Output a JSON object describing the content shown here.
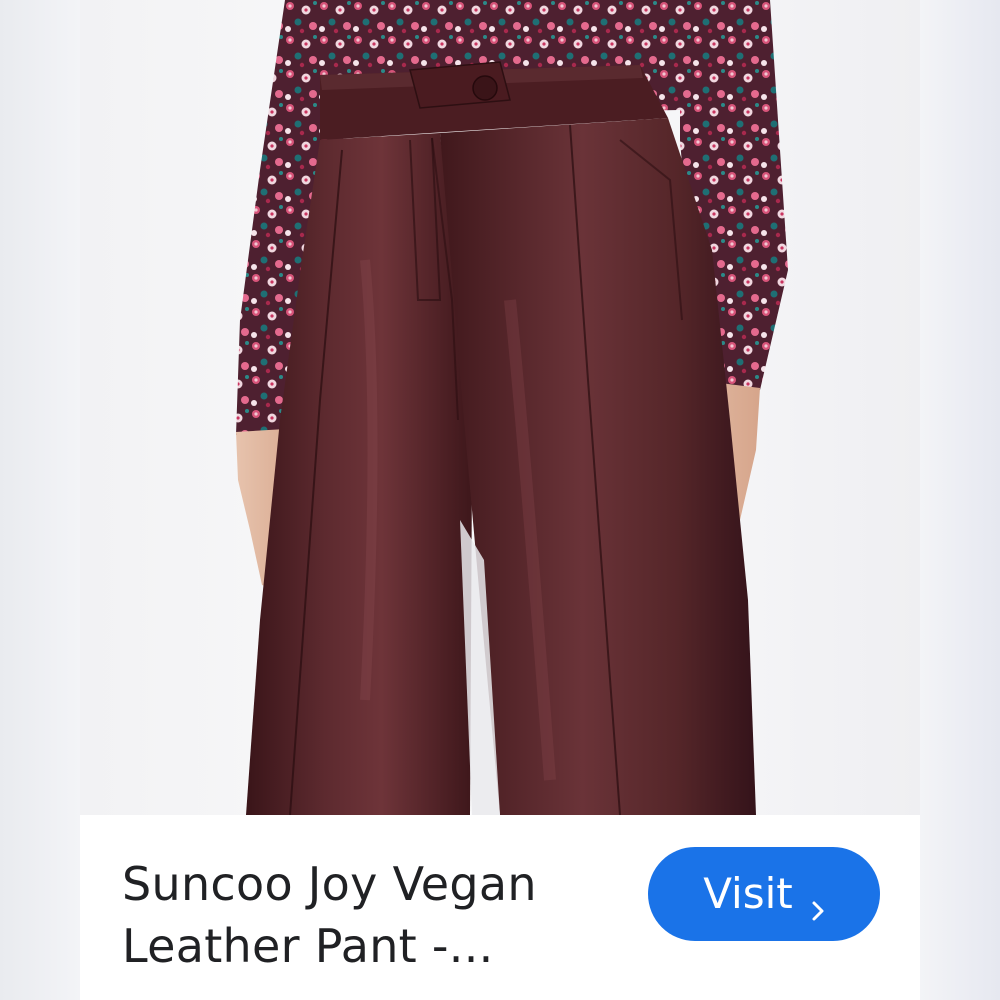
{
  "product": {
    "title": "Suncoo Joy Vegan Leather Pant -...",
    "image_alt": "Model wearing burgundy vegan leather wide-leg pants and a floral print top"
  },
  "actions": {
    "visit_label": "Visit",
    "visit_icon": "chevron-right-icon"
  },
  "colors": {
    "accent": "#1a73e8",
    "title_text": "#202124",
    "pants": "#4a1e22",
    "blouse": "#5b2536"
  }
}
